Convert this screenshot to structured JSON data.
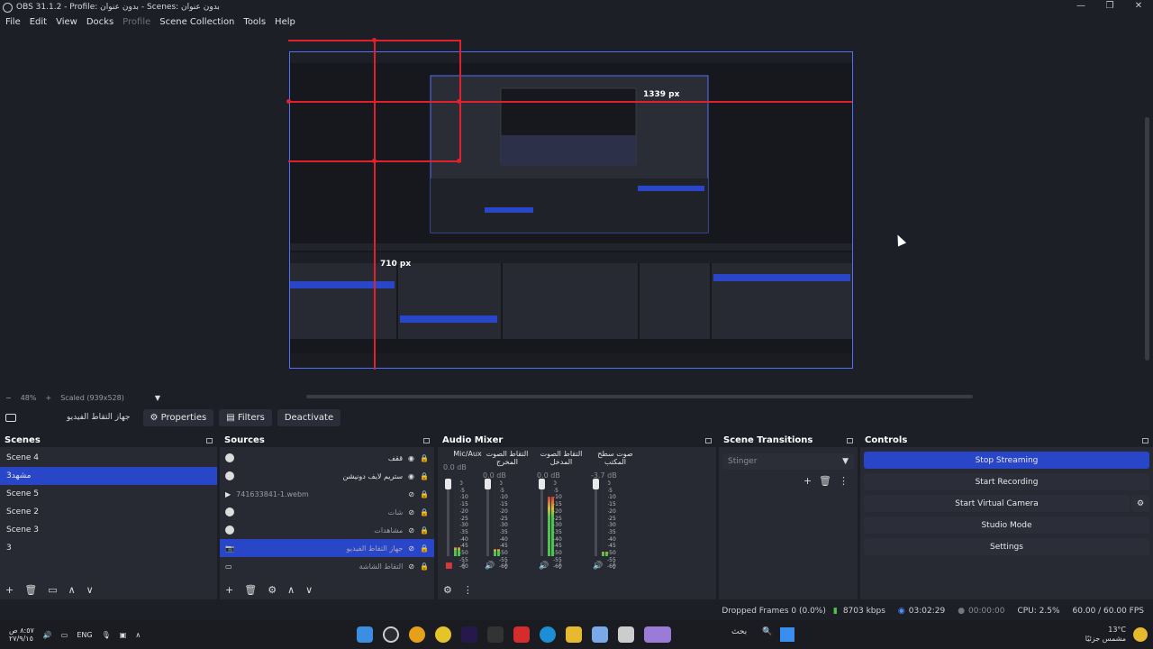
{
  "window": {
    "title": "OBS 31.1.2 - Profile: بدون عنوان - Scenes: بدون عنوان",
    "controls": [
      "—",
      "❐",
      "✕"
    ]
  },
  "menu": [
    "File",
    "Edit",
    "View",
    "Docks",
    "Profile",
    "Scene Collection",
    "Tools",
    "Help"
  ],
  "preview": {
    "measure_horizontal": "1339 px",
    "measure_vertical": "710 px"
  },
  "preview_status": {
    "zoom_out": "−",
    "zoom": "48%",
    "zoom_in": "+",
    "scale": "Scaled (939x528)",
    "dropdown": "▼"
  },
  "source_toolbar": {
    "selected_source": "جهاز التقاط الفيديو",
    "properties": "Properties",
    "filters": "Filters",
    "deactivate": "Deactivate"
  },
  "scenes": {
    "title": "Scenes",
    "items": [
      "Scene 4",
      "مشهد3",
      "Scene 5",
      "Scene 2",
      "Scene 3",
      "3"
    ],
    "selected_index": 1,
    "footer": [
      "+",
      "🗑",
      "▭",
      "∧",
      "∨"
    ]
  },
  "sources": {
    "title": "Sources",
    "items": [
      {
        "name": "ققف",
        "icon": "globe-icon"
      },
      {
        "name": "ستريم لايف دونيشن",
        "icon": "globe-icon"
      },
      {
        "name": "741633841-1.webm",
        "icon": "play-icon"
      },
      {
        "name": "شات",
        "icon": "globe-icon"
      },
      {
        "name": "مشاهدات",
        "icon": "globe-icon"
      },
      {
        "name": "جهاز التقاط الفيديو",
        "icon": "camera-icon"
      },
      {
        "name": "التقاط الشاشة",
        "icon": "display-icon"
      }
    ],
    "selected_index": 5,
    "footer": [
      "+",
      "🗑",
      "⚙",
      "∧",
      "∨"
    ]
  },
  "audio_mixer": {
    "title": "Audio Mixer",
    "channels": [
      {
        "name": "Mic/Aux",
        "db": "0.0 dB",
        "level": 0.12
      },
      {
        "name": "التقاط الصوت المخرج",
        "db": "0.0 dB",
        "level": 0.1
      },
      {
        "name": "التقاط الصوت المدخل",
        "db": "0.0 dB",
        "level": 0.78
      },
      {
        "name": "صوت سطح المكتب",
        "db": "-3.7 dB",
        "level": 0.06
      }
    ],
    "scale": [
      "0",
      "-5",
      "-10",
      "-15",
      "-20",
      "-25",
      "-30",
      "-35",
      "-40",
      "-45",
      "-50",
      "-55",
      "-60"
    ]
  },
  "scene_transitions": {
    "title": "Scene Transitions",
    "selected": "Stinger"
  },
  "controls": {
    "title": "Controls",
    "buttons": [
      "Stop Streaming",
      "Start Recording",
      "Start Virtual Camera",
      "Studio Mode",
      "Settings"
    ]
  },
  "status": {
    "dropped_frames": "Dropped Frames 0 (0.0%)",
    "bitrate": "8703 kbps",
    "stream_time": "03:02:29",
    "record_time": "00:00:00",
    "cpu": "CPU: 2.5%",
    "fps": "60.00 / 60.00 FPS"
  },
  "taskbar": {
    "time": "٨:٥٧ ص",
    "date": "٢٧/٩/١٥",
    "lang": "ENG",
    "search": "بحث",
    "temperature": "13°C",
    "weather": "مشمس جزئيًا"
  },
  "colors": {
    "accent": "#2a46c8",
    "bg": "#1d1f26",
    "dock": "#272a33",
    "red_guide": "#e0202c"
  }
}
